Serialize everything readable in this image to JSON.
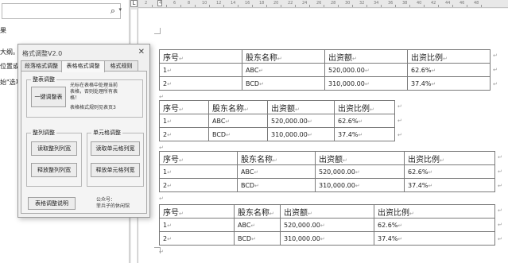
{
  "nav_pane": {
    "search_placeholder": "",
    "search_icon": "search-icon",
    "lines": [
      "果",
      "大纲。",
      "位置或",
      "始\"选项"
    ]
  },
  "ruler": {
    "ticks": [
      "2",
      "4",
      "6",
      "8",
      "10",
      "12",
      "14",
      "16",
      "18",
      "20",
      "22",
      "24",
      "26",
      "28",
      "30",
      "32",
      "34",
      "36",
      "38",
      "40",
      "42",
      "44",
      "46",
      "48"
    ],
    "tab_selector": "L"
  },
  "dialog": {
    "title": "格式调整V2.0",
    "close_glyph": "✕",
    "tabs": [
      "段落格式调整",
      "表格格式调整",
      "格式规则"
    ],
    "active_tab": 1,
    "table_group": {
      "title": "整表调整",
      "button": "一键调整表",
      "note_lines": [
        "光标在表格中处理当前",
        "表格，否则处理所有表",
        "格！"
      ],
      "rule_note": "表格格式规则见表页3"
    },
    "column_group": {
      "title": "整列调整",
      "buttons": [
        "读取整列列宽",
        "释放整列列宽"
      ]
    },
    "cell_group": {
      "title": "单元格调整",
      "buttons": [
        "读取单元格列宽",
        "释放单元格列宽"
      ]
    },
    "help_button": "表格调整说明",
    "footer_lines": [
      "公众号：",
      "菲兵子的休闲馆"
    ]
  },
  "document": {
    "pilcrow": "↵",
    "tables": [
      {
        "headers": [
          "序号",
          "股东名称",
          "出资额",
          "出资比例"
        ],
        "rows": [
          [
            "1",
            "ABC",
            "520,000.00",
            "62.6%"
          ],
          [
            "2",
            "BCD",
            "310,000.00",
            "37.4%"
          ]
        ]
      },
      {
        "headers": [
          "序号",
          "股东名称",
          "出资额",
          "出资比例"
        ],
        "rows": [
          [
            "1",
            "ABC",
            "520,000.00",
            "62.6%"
          ],
          [
            "2",
            "BCD",
            "310,000.00",
            "37.4%"
          ]
        ]
      },
      {
        "headers": [
          "序号",
          "股东名称",
          "出资额",
          "出资比例"
        ],
        "rows": [
          [
            "1",
            "ABC",
            "520,000.00",
            "62.6%"
          ],
          [
            "2",
            "BCD",
            "310,000.00",
            "37.4%"
          ]
        ]
      },
      {
        "headers": [
          "序号",
          "股东名称",
          "出资额",
          "出资比例"
        ],
        "rows": [
          [
            "1",
            "ABC",
            "520,000.00",
            "62.6%"
          ],
          [
            "2",
            "BCD",
            "310,000.00",
            "37.4%"
          ]
        ]
      }
    ]
  }
}
